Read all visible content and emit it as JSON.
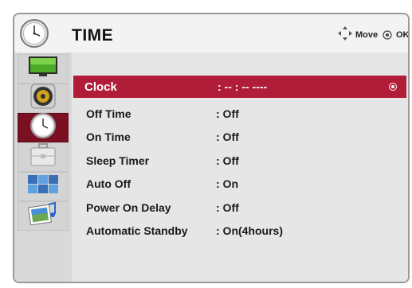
{
  "menu": {
    "title": "TIME",
    "hints": {
      "move_label": "Move",
      "ok_label": "OK"
    }
  },
  "sidebar": {
    "items": [
      {
        "icon": "monitor-icon"
      },
      {
        "icon": "speaker-icon"
      },
      {
        "icon": "clock-icon",
        "active": true
      },
      {
        "icon": "toolbox-icon"
      },
      {
        "icon": "multi-screen-icon"
      },
      {
        "icon": "photo-music-icon"
      }
    ]
  },
  "settings": [
    {
      "label": "Clock",
      "value": ": -- : -- ----",
      "selected": true
    },
    {
      "label": "Off Time",
      "value": ": Off"
    },
    {
      "label": "On Time",
      "value": ": Off"
    },
    {
      "label": "Sleep Timer",
      "value": ": Off"
    },
    {
      "label": "Auto Off",
      "value": ": On"
    },
    {
      "label": "Power On Delay",
      "value": ": Off"
    },
    {
      "label": "Automatic Standby",
      "value": ": On(4hours)"
    }
  ],
  "colors": {
    "selected_row": "#b11c38",
    "active_sidebar": "#7a1022"
  }
}
